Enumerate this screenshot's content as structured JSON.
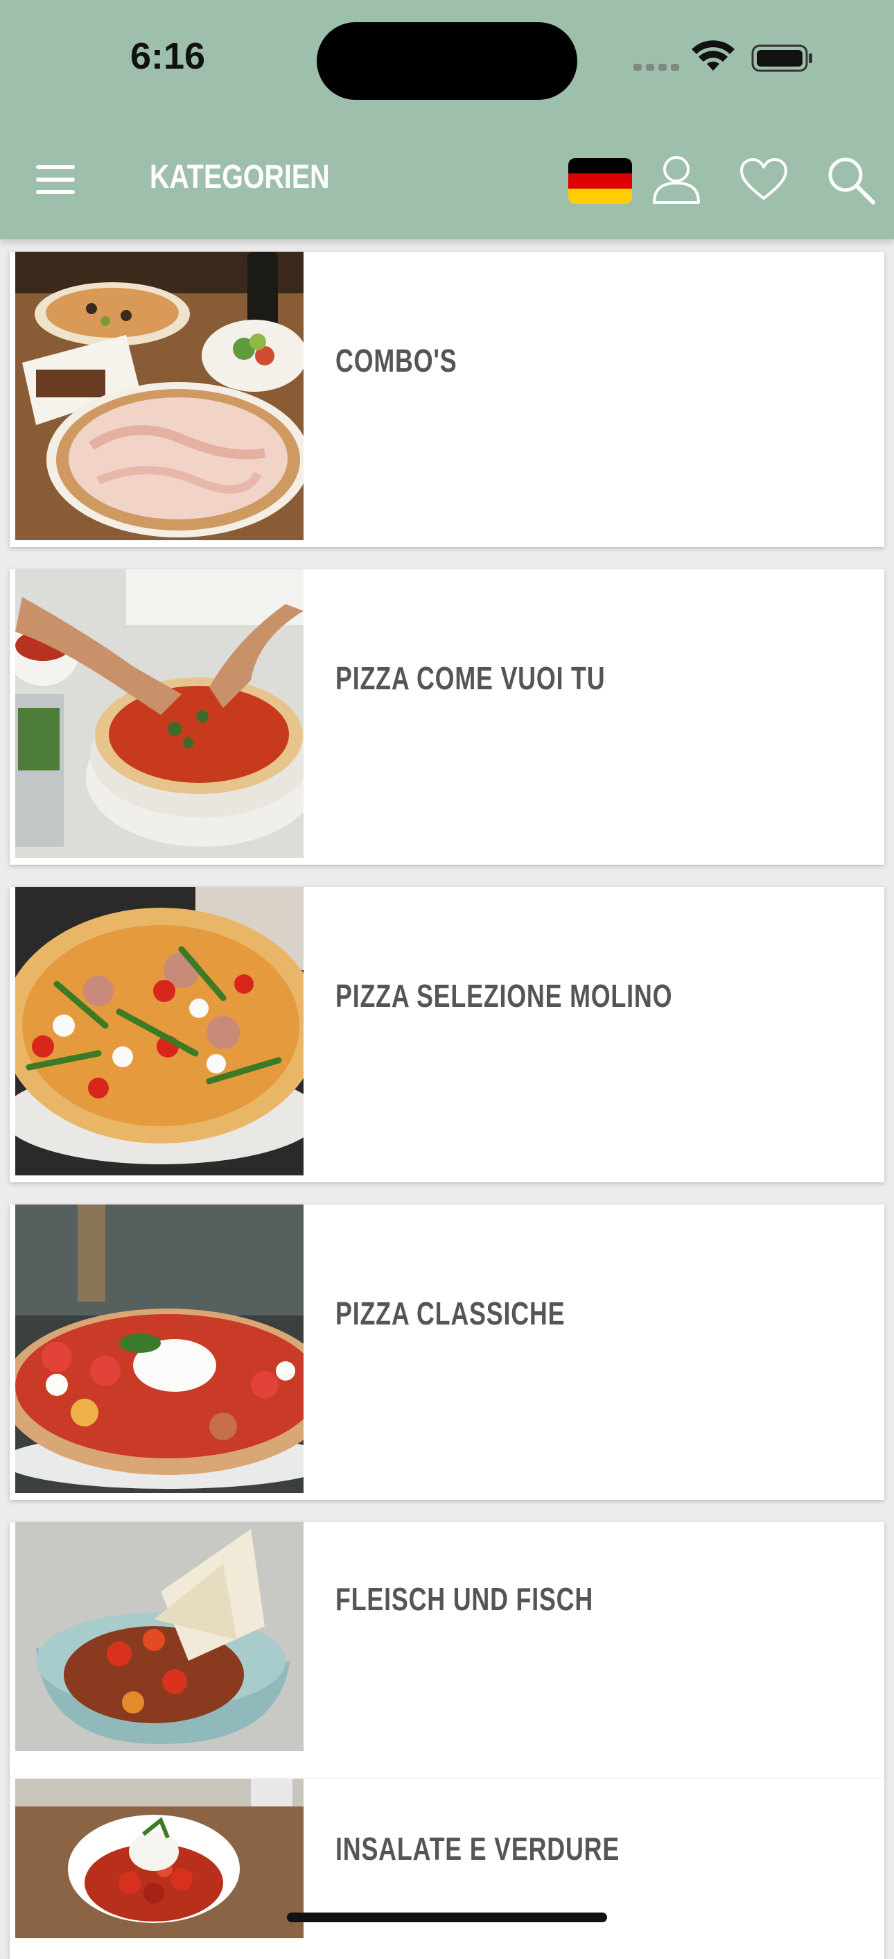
{
  "status_bar": {
    "time": "6:16"
  },
  "header": {
    "title": "KATEGORIEN",
    "flag": [
      "#000000",
      "#dd0000",
      "#ffce00"
    ]
  },
  "categories": [
    {
      "label": "COMBO'S",
      "image": "pizza-combo-table"
    },
    {
      "label": "PIZZA COME VUOI TU",
      "image": "pizza-being-made"
    },
    {
      "label": "PIZZA SELEZIONE MOLINO",
      "image": "pizza-arugula-prosciutto"
    },
    {
      "label": "PIZZA CLASSICHE",
      "image": "pizza-burrata"
    },
    {
      "label": "FLEISCH UND FISCH",
      "image": "grilled-vegetables-bowl"
    },
    {
      "label": "INSALATE E VERDURE",
      "image": "tomato-mozzarella-bowl"
    }
  ],
  "colors": {
    "header_bg": "#9dbfab",
    "label": "#555555"
  }
}
